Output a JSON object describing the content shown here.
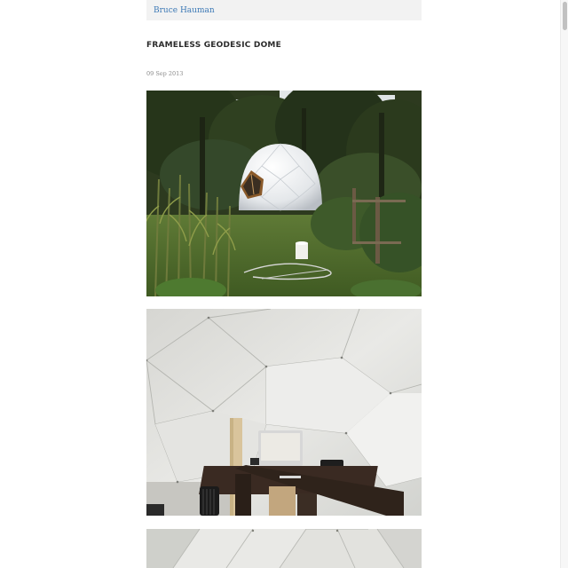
{
  "header": {
    "site_name": "Bruce Hauman"
  },
  "post": {
    "title": "FRAMELESS GEODESIC DOME",
    "date": "09 Sep 2013"
  },
  "photos": [
    {
      "subject": "geodesic-dome-exterior-garden"
    },
    {
      "subject": "geodesic-dome-interior-desk"
    },
    {
      "subject": "geodesic-dome-interior-ceiling"
    }
  ]
}
